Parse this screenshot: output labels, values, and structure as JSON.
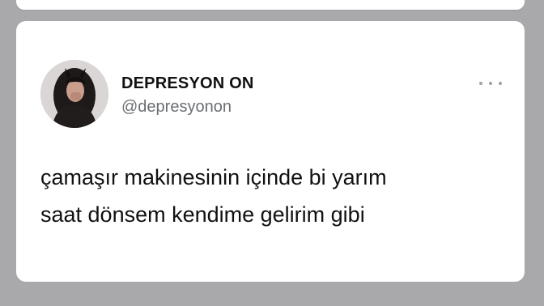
{
  "tweet": {
    "author": {
      "display_name": "DEPRESYON ON",
      "handle": "@depresyonon",
      "avatar_icon": "profile-photo"
    },
    "more_icon": "more-horizontal-icon",
    "text_lines": [
      "çamaşır makinesinin içinde bi yarım",
      "saat dönsem kendime gelirim gibi"
    ]
  }
}
